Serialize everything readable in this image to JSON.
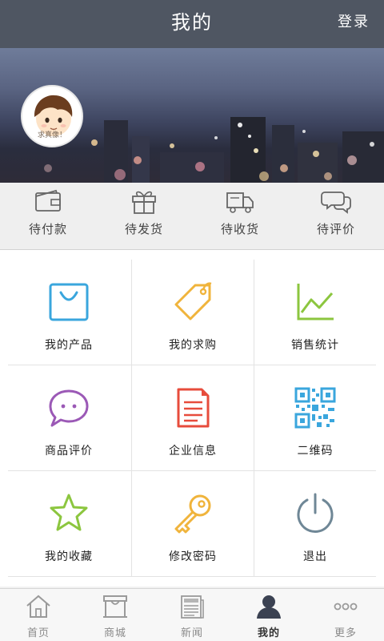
{
  "header": {
    "title": "我的",
    "login_label": "登录"
  },
  "profile": {
    "avatar_caption": "求真像！"
  },
  "orders": [
    {
      "label": "待付款",
      "icon": "wallet-icon"
    },
    {
      "label": "待发货",
      "icon": "gift-icon"
    },
    {
      "label": "待收货",
      "icon": "truck-icon"
    },
    {
      "label": "待评价",
      "icon": "chat-bubbles-icon"
    }
  ],
  "menu": [
    {
      "label": "我的产品",
      "icon": "shopping-bag-icon",
      "color": "#3aa6dd"
    },
    {
      "label": "我的求购",
      "icon": "price-tag-icon",
      "color": "#f0b43c"
    },
    {
      "label": "销售统计",
      "icon": "line-chart-icon",
      "color": "#8cc63f"
    },
    {
      "label": "商品评价",
      "icon": "speech-bubble-icon",
      "color": "#9b59b6"
    },
    {
      "label": "企业信息",
      "icon": "document-icon",
      "color": "#e74c3c"
    },
    {
      "label": "二维码",
      "icon": "qr-code-icon",
      "color": "#3aa6dd"
    },
    {
      "label": "我的收藏",
      "icon": "star-icon",
      "color": "#8cc63f"
    },
    {
      "label": "修改密码",
      "icon": "key-icon",
      "color": "#f0b43c"
    },
    {
      "label": "退出",
      "icon": "power-icon",
      "color": "#6f8796"
    }
  ],
  "tabs": [
    {
      "label": "首页",
      "icon": "home-icon",
      "active": false
    },
    {
      "label": "商城",
      "icon": "store-icon",
      "active": false
    },
    {
      "label": "新闻",
      "icon": "news-icon",
      "active": false
    },
    {
      "label": "我的",
      "icon": "user-icon",
      "active": true
    },
    {
      "label": "更多",
      "icon": "more-icon",
      "active": false
    }
  ],
  "colors": {
    "header_bg": "#4f5662",
    "grid_border": "#e3e3e3",
    "active_tab": "#333333",
    "inactive_tab": "#8a8a8a"
  }
}
